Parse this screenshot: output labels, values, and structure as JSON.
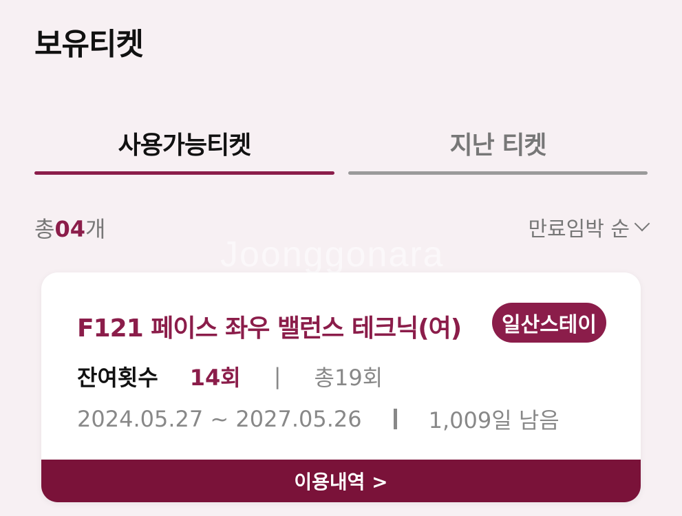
{
  "header": {
    "title": "보유티켓"
  },
  "tabs": [
    {
      "label": "사용가능티켓",
      "active": true
    },
    {
      "label": "지난 티켓",
      "active": false
    }
  ],
  "summary": {
    "prefix": "총",
    "count": "04",
    "suffix": "개"
  },
  "sort": {
    "label": "만료임박 순"
  },
  "watermark": "Joonggonara",
  "tickets": [
    {
      "title": "F121 페이스 좌우 밸런스 테크닉(여)",
      "badge": "일산스테이",
      "remaining_label": "잔여횟수",
      "remaining_value": "14회",
      "separator": "|",
      "total": "총19회",
      "date_range": "2024.05.27 ~ 2027.05.26",
      "days_left": "1,009일 남음",
      "footer_label": "이용내역 >"
    }
  ],
  "colors": {
    "accent": "#8b1d4a",
    "footer": "#7a1239",
    "background": "#f7f0f3"
  }
}
